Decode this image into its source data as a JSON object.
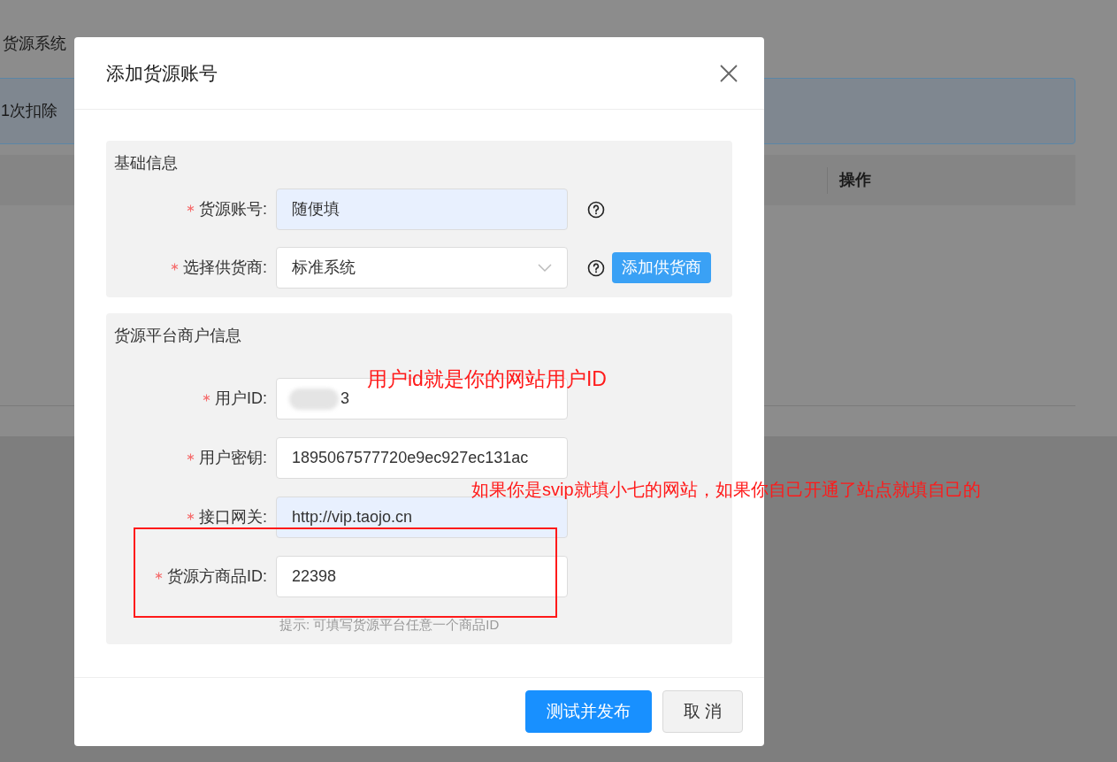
{
  "background": {
    "title": "货源系统",
    "notice": "1次扣除",
    "table_header": "操作"
  },
  "dialog": {
    "title": "添加货源账号",
    "sections": [
      {
        "title": "基础信息",
        "fields": [
          {
            "kind": "text",
            "label": "货源账号:",
            "required": true,
            "value": "随便填",
            "autofilled": true,
            "help": true
          },
          {
            "kind": "select",
            "label": "选择供货商:",
            "required": true,
            "value": "标准系统",
            "autofilled": false,
            "help": true,
            "action": "添加供货商"
          }
        ]
      },
      {
        "title": "货源平台商户信息",
        "fields": [
          {
            "kind": "redacted",
            "label": "用户ID:",
            "required": true,
            "value": "3",
            "autofilled": false,
            "help": false
          },
          {
            "kind": "text",
            "label": "用户密钥:",
            "required": true,
            "value": "1895067577720e9ec927ec131ac",
            "autofilled": false,
            "help": false
          },
          {
            "kind": "text",
            "label": "接口网关:",
            "required": true,
            "value": "http://vip.taojo.cn",
            "autofilled": true,
            "help": false
          },
          {
            "kind": "text",
            "label": "货源方商品ID:",
            "required": true,
            "value": "22398",
            "autofilled": false,
            "help": false,
            "hint": "提示: 可填写货源平台任意一个商品ID"
          }
        ]
      }
    ],
    "buttons": [
      {
        "kind": "primary",
        "label": "测试并发布"
      },
      {
        "kind": "default",
        "label": "取 消"
      }
    ]
  },
  "annotations": [
    {
      "kind": "note",
      "text": "用户id就是你的网站用户ID"
    },
    {
      "kind": "note",
      "text": "如果你是svip就填小七的网站，如果你自己开通了站点就填自己的"
    },
    {
      "kind": "frame"
    }
  ]
}
